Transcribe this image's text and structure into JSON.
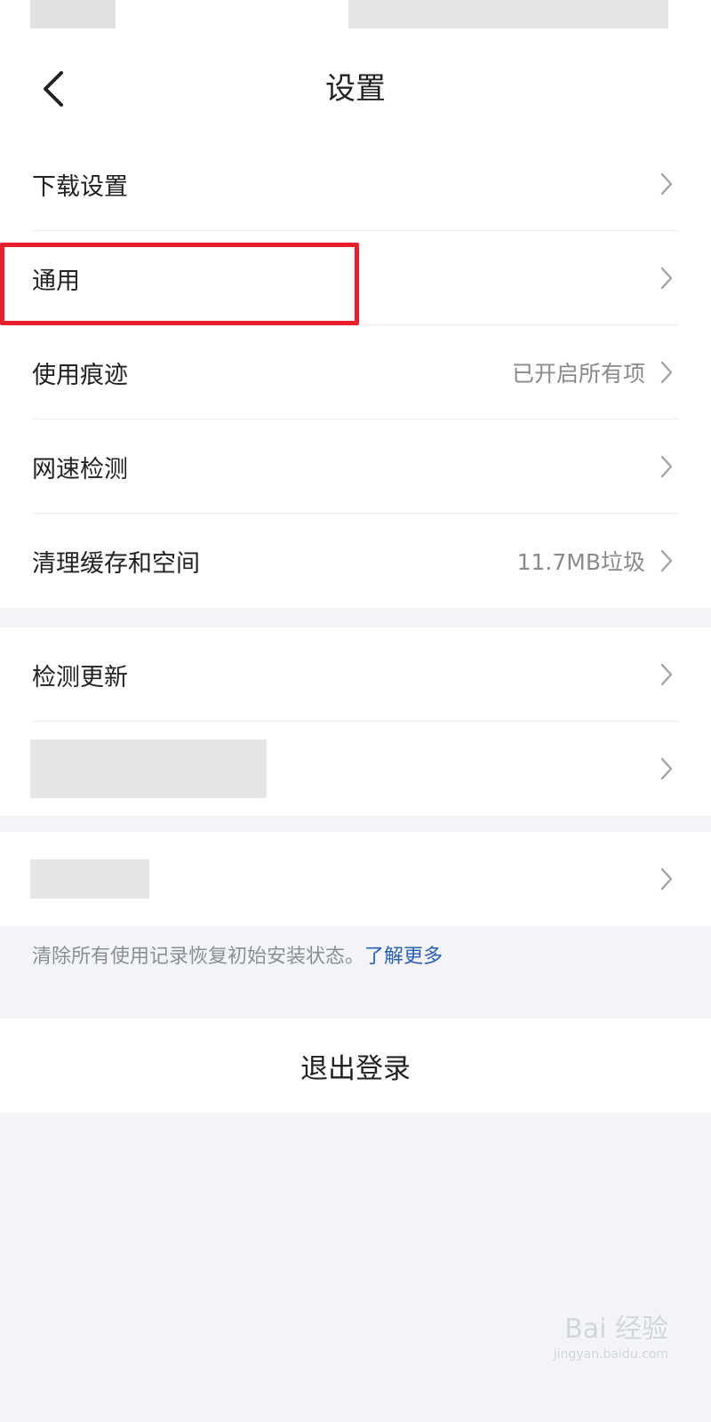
{
  "header": {
    "title": "设置"
  },
  "sections": {
    "main": [
      {
        "label": "下载设置",
        "value": ""
      },
      {
        "label": "通用",
        "value": ""
      },
      {
        "label": "使用痕迹",
        "value": "已开启所有项"
      },
      {
        "label": "网速检测",
        "value": ""
      },
      {
        "label": "清理缓存和空间",
        "value": "11.7MB垃圾"
      }
    ],
    "update": {
      "label": "检测更新"
    }
  },
  "note": {
    "text": "清除所有使用记录恢复初始安装状态。",
    "link": "了解更多"
  },
  "logout": {
    "label": "退出登录"
  },
  "watermark": {
    "brand": "Bai 经验",
    "url": "jingyan.baidu.com"
  },
  "colors": {
    "highlight": "#e8202c",
    "link": "#2b5fb8",
    "background": "#f2f4f7"
  },
  "icons": {
    "back": "back-arrow-icon",
    "chevron": "chevron-right-icon"
  }
}
